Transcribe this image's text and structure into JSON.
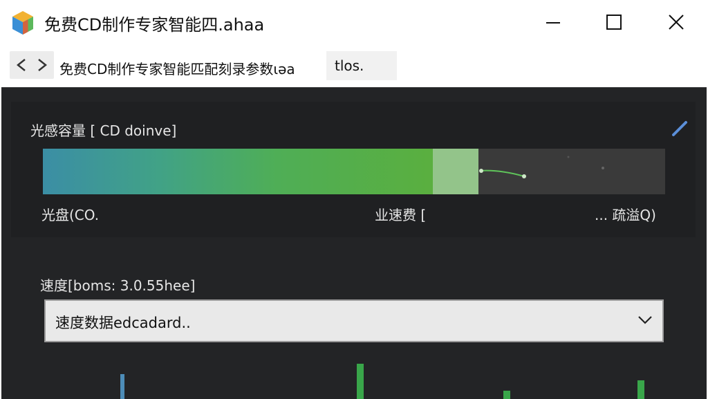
{
  "window": {
    "title": "免费CD制作专家智能四.ahaa",
    "controls": {
      "minimize": "minimize-icon",
      "maximize": "maximize-icon",
      "close": "close-icon"
    }
  },
  "nav": {
    "arrows_icon": "back-forward-icon",
    "breadcrumb": "免费CD制作专家智能匹配刻录参数ιəa",
    "breadcrumb_tail": "tlos."
  },
  "capacity": {
    "title": "光感容量 [   CD doinve]",
    "edit_icon": "pencil-icon",
    "used_fraction": 0.627,
    "buffer_fraction": 0.073,
    "labels": {
      "left": "光盘(CO.",
      "middle": "业速费 [",
      "right": "... 疏溢Q)"
    }
  },
  "speed": {
    "title": "速度[boms:  3.0.55hee]",
    "selected": "速度数据edcadard..",
    "chevron_icon": "chevron-down-icon"
  },
  "colors": {
    "panel": "#232426",
    "bar_start": "#3b8ea5",
    "bar_end": "#5aaf3f",
    "buffer": "#93c48a",
    "graph_blue": "#4d8db8",
    "graph_green": "#39a64a"
  },
  "speed_graph": {
    "levels": [
      0.6,
      0.85,
      0.2,
      0.45
    ]
  }
}
